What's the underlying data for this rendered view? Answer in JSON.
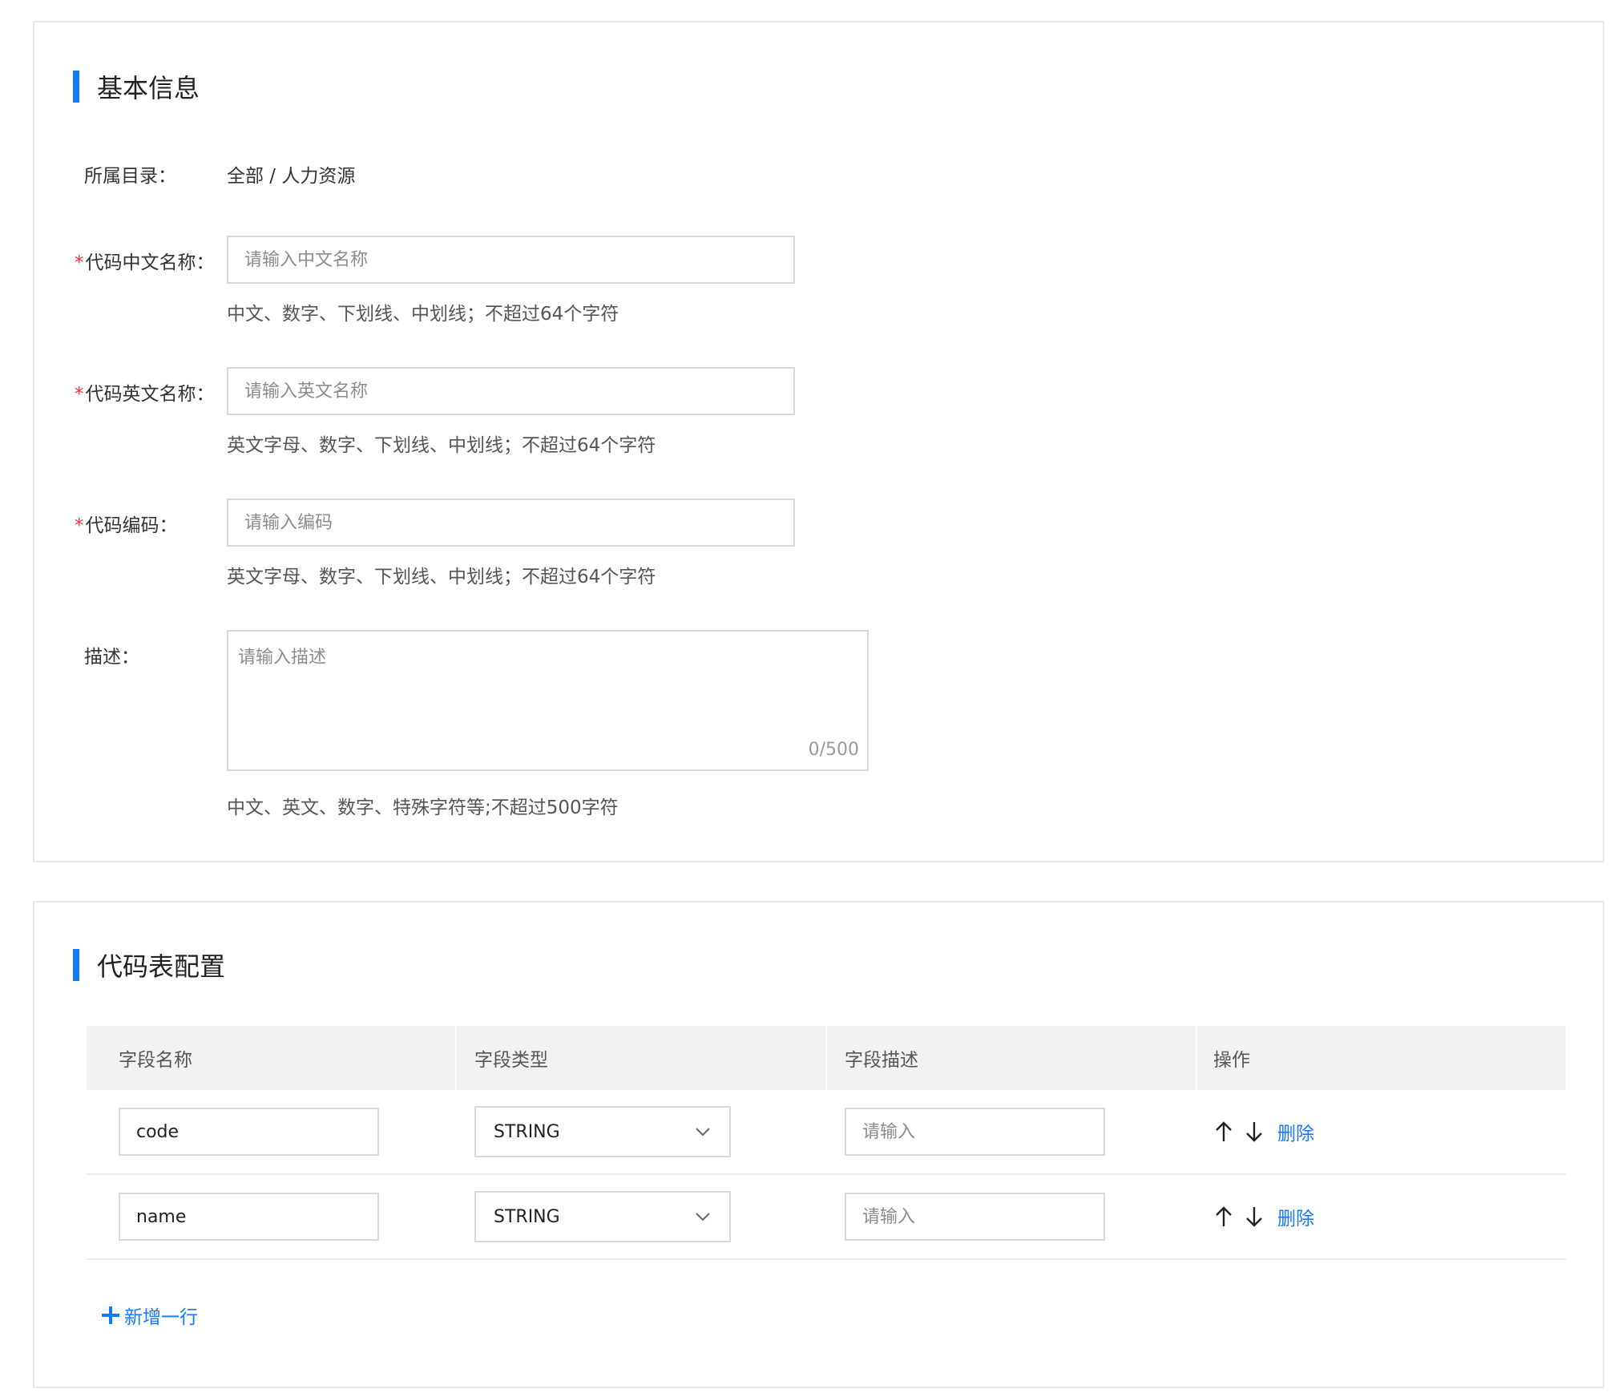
{
  "basic": {
    "title": "基本信息",
    "catalog_label": "所属目录：",
    "catalog_value": "全部 / 人力资源",
    "cn_name": {
      "label": "代码中文名称：",
      "placeholder": "请输入中文名称",
      "hint": "中文、数字、下划线、中划线；不超过64个字符"
    },
    "en_name": {
      "label": "代码英文名称：",
      "placeholder": "请输入英文名称",
      "hint": "英文字母、数字、下划线、中划线；不超过64个字符"
    },
    "code": {
      "label": "代码编码：",
      "placeholder": "请输入编码",
      "hint": "英文字母、数字、下划线、中划线；不超过64个字符"
    },
    "description": {
      "label": "描述：",
      "placeholder": "请输入描述",
      "counter": "0/500",
      "hint": "中文、英文、数字、特殊字符等;不超过500字符"
    },
    "required_mark": "*"
  },
  "config": {
    "title": "代码表配置",
    "columns": [
      "字段名称",
      "字段类型",
      "字段描述",
      "操作"
    ],
    "rows": [
      {
        "field_name": "code",
        "field_type": "STRING",
        "desc_placeholder": "请输入",
        "delete_label": "删除"
      },
      {
        "field_name": "name",
        "field_type": "STRING",
        "desc_placeholder": "请输入",
        "delete_label": "删除"
      }
    ],
    "add_row_label": "新增一行"
  },
  "colors": {
    "accent": "#1677ff",
    "required": "#e23b3b",
    "header_bg": "#f2f2f2"
  },
  "icons": [
    "arrow-up-icon",
    "arrow-down-icon",
    "chevron-down-icon",
    "plus-icon"
  ]
}
